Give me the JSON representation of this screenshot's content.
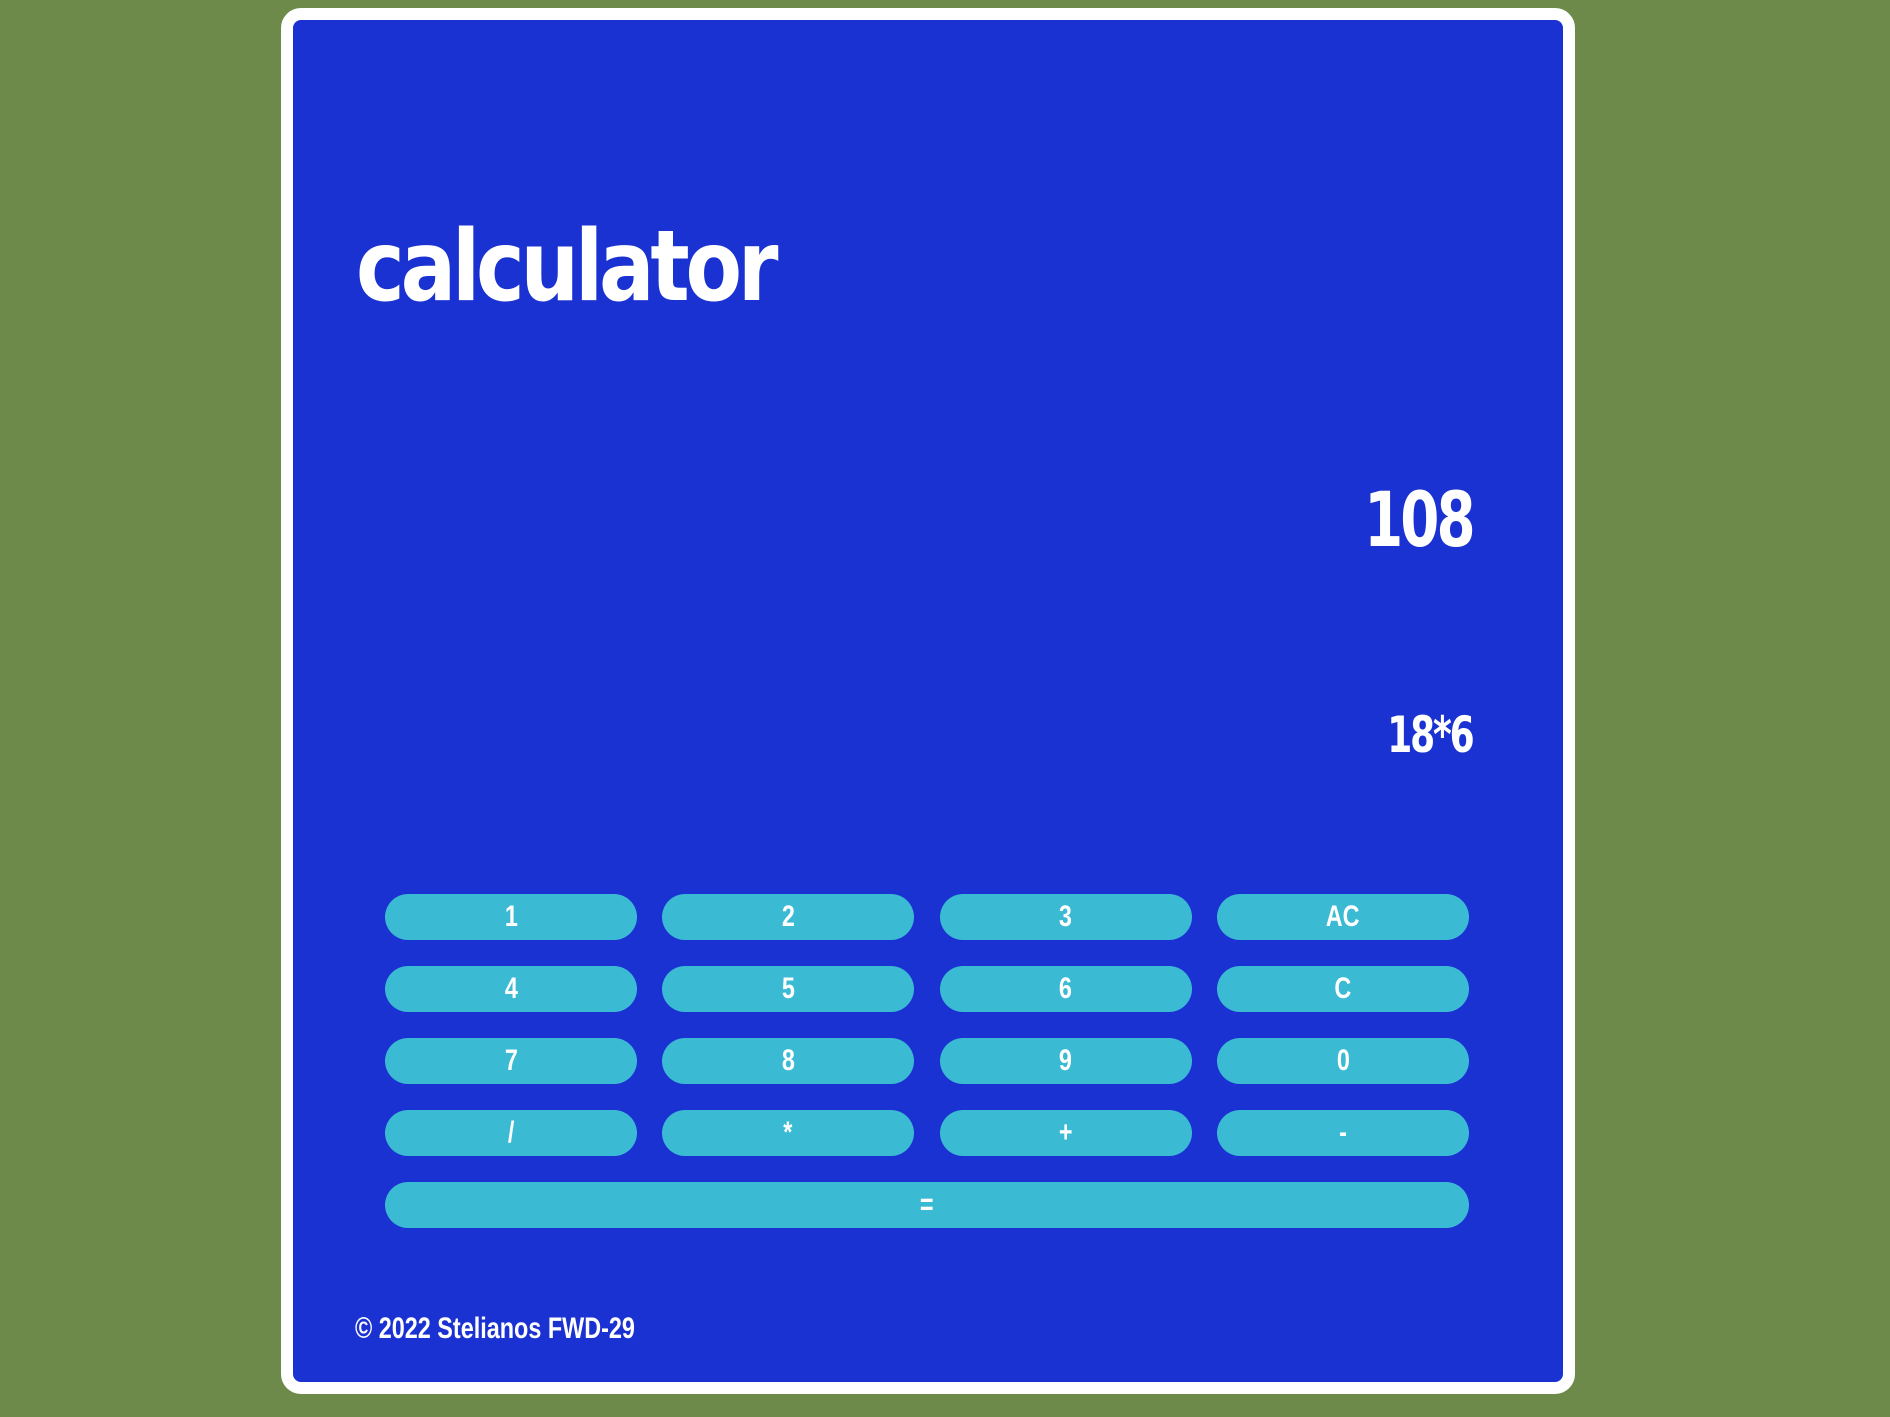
{
  "app": {
    "title": "calculator"
  },
  "display": {
    "result": "108",
    "expression": "18*6"
  },
  "keys": {
    "k1": "1",
    "k2": "2",
    "k3": "3",
    "ac": "AC",
    "k4": "4",
    "k5": "5",
    "k6": "6",
    "c": "C",
    "k7": "7",
    "k8": "8",
    "k9": "9",
    "k0": "0",
    "divide": "/",
    "multiply": "*",
    "plus": "+",
    "minus": "-",
    "equals": "="
  },
  "footer": {
    "text": "© 2022 Stelianos FWD-29"
  },
  "colors": {
    "page_background": "#6d8a4b",
    "card_background": "#1a32d2",
    "card_border": "#ffffff",
    "key_background": "#3bbad3",
    "text": "#ffffff"
  }
}
